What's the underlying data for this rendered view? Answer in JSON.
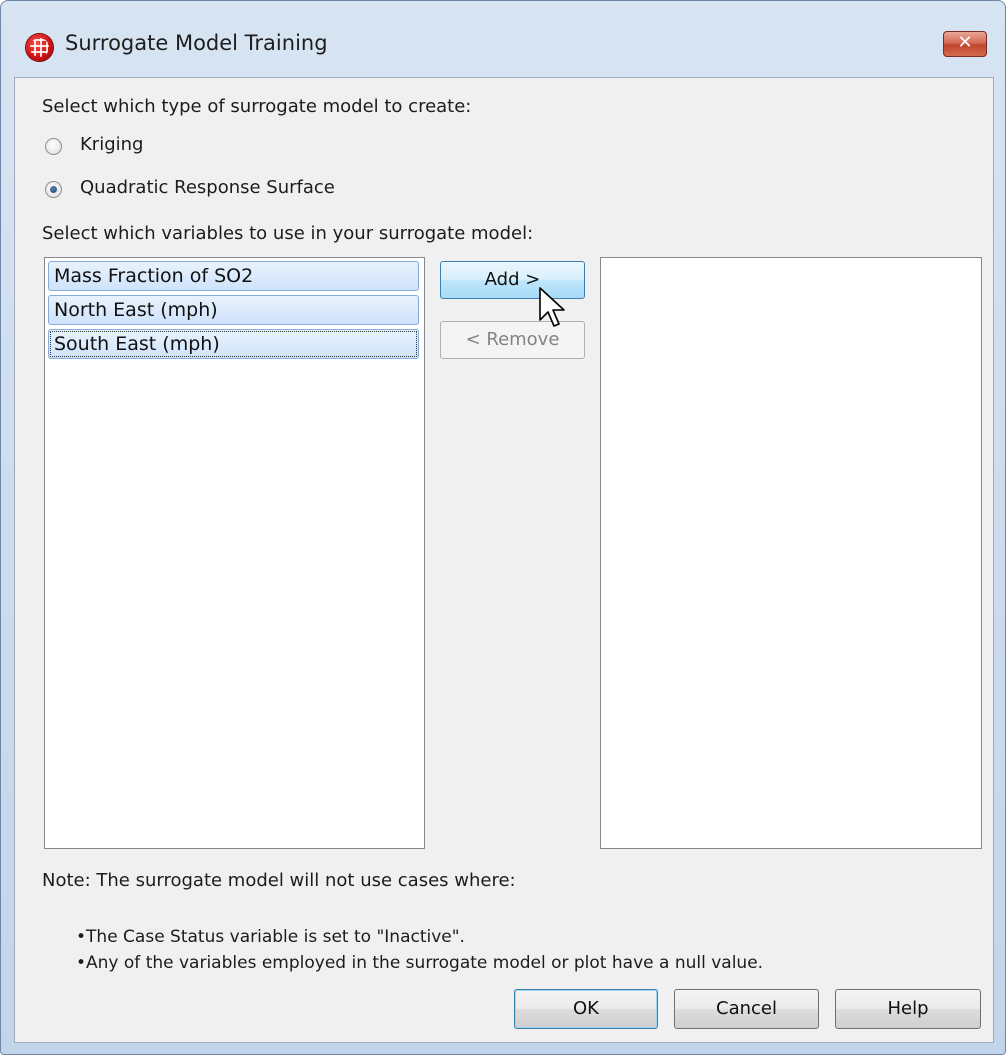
{
  "window": {
    "title": "Surrogate Model Training",
    "close_glyph": "✕"
  },
  "model_type": {
    "prompt": "Select which type of surrogate model to create:",
    "options": [
      {
        "label": "Kriging",
        "selected": false
      },
      {
        "label": "Quadratic Response Surface",
        "selected": true
      }
    ]
  },
  "variables": {
    "prompt": "Select which variables to use in your surrogate model:",
    "available": [
      "Mass Fraction of SO2",
      "North East (mph)",
      "South East (mph)"
    ],
    "selected": []
  },
  "buttons": {
    "add": "Add >",
    "remove": "< Remove",
    "ok": "OK",
    "cancel": "Cancel",
    "help": "Help"
  },
  "note": {
    "heading": "Note: The surrogate model will not use cases where:",
    "bullets": [
      "The Case Status variable is set to \"Inactive\".",
      "Any of the variables employed in the surrogate model or plot have a null value."
    ]
  },
  "colors": {
    "selection": "#cfe3fb",
    "accent": "#3c7fb1"
  }
}
